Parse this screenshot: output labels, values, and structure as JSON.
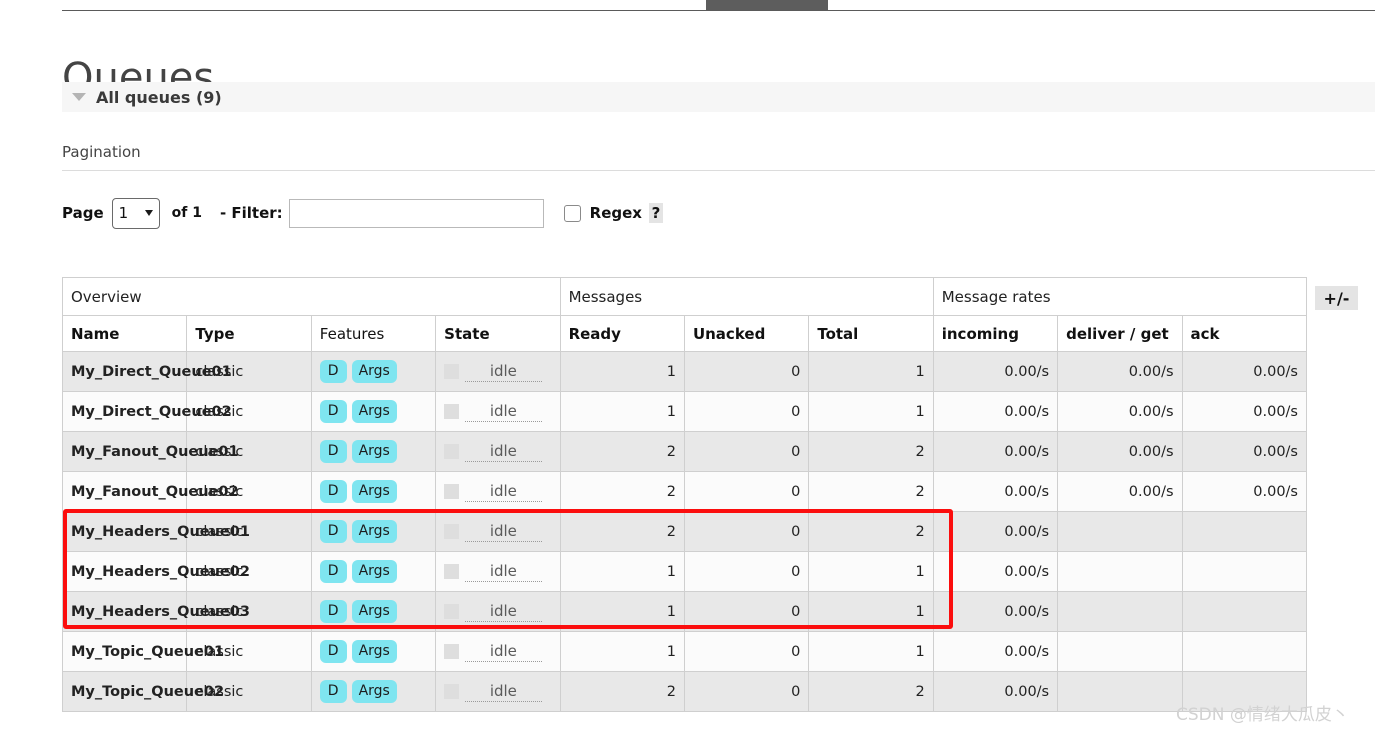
{
  "page": {
    "title": "Queues",
    "section_label": "All queues (9)",
    "watermark": "CSDN @情绪大瓜皮丶"
  },
  "pagination": {
    "heading": "Pagination",
    "page_label": "Page",
    "page_value": "1",
    "of_label": "of 1",
    "filter_label": "- Filter:",
    "filter_value": "",
    "filter_placeholder": "",
    "regex_label": "Regex",
    "help_label": "?",
    "page_options": [
      "1"
    ]
  },
  "table": {
    "toggle_columns_label": "+/-",
    "group_headers": [
      {
        "label": "Overview",
        "span": 4
      },
      {
        "label": "Messages",
        "span": 3
      },
      {
        "label": "Message rates",
        "span": 3
      }
    ],
    "columns": [
      {
        "label": "Name",
        "align": "left",
        "bold": true
      },
      {
        "label": "Type",
        "align": "left",
        "bold": true
      },
      {
        "label": "Features",
        "align": "left",
        "bold": false
      },
      {
        "label": "State",
        "align": "left",
        "bold": true
      },
      {
        "label": "Ready",
        "align": "left",
        "bold": true
      },
      {
        "label": "Unacked",
        "align": "left",
        "bold": true
      },
      {
        "label": "Total",
        "align": "left",
        "bold": true
      },
      {
        "label": "incoming",
        "align": "left",
        "bold": true
      },
      {
        "label": "deliver / get",
        "align": "left",
        "bold": true
      },
      {
        "label": "ack",
        "align": "left",
        "bold": true
      }
    ],
    "feature_badges": [
      "D",
      "Args"
    ],
    "rows": [
      {
        "name": "My_Direct_Queue01",
        "type": "classic",
        "features": [
          "D",
          "Args"
        ],
        "state": "idle",
        "ready": "1",
        "unacked": "0",
        "total": "1",
        "incoming": "0.00/s",
        "deliver_get": "0.00/s",
        "ack": "0.00/s",
        "highlighted": false
      },
      {
        "name": "My_Direct_Queue02",
        "type": "classic",
        "features": [
          "D",
          "Args"
        ],
        "state": "idle",
        "ready": "1",
        "unacked": "0",
        "total": "1",
        "incoming": "0.00/s",
        "deliver_get": "0.00/s",
        "ack": "0.00/s",
        "highlighted": false
      },
      {
        "name": "My_Fanout_Queue01",
        "type": "classic",
        "features": [
          "D",
          "Args"
        ],
        "state": "idle",
        "ready": "2",
        "unacked": "0",
        "total": "2",
        "incoming": "0.00/s",
        "deliver_get": "0.00/s",
        "ack": "0.00/s",
        "highlighted": false
      },
      {
        "name": "My_Fanout_Queue02",
        "type": "classic",
        "features": [
          "D",
          "Args"
        ],
        "state": "idle",
        "ready": "2",
        "unacked": "0",
        "total": "2",
        "incoming": "0.00/s",
        "deliver_get": "0.00/s",
        "ack": "0.00/s",
        "highlighted": false
      },
      {
        "name": "My_Headers_Queue01",
        "type": "classic",
        "features": [
          "D",
          "Args"
        ],
        "state": "idle",
        "ready": "2",
        "unacked": "0",
        "total": "2",
        "incoming": "0.00/s",
        "deliver_get": "",
        "ack": "",
        "highlighted": true
      },
      {
        "name": "My_Headers_Queue02",
        "type": "classic",
        "features": [
          "D",
          "Args"
        ],
        "state": "idle",
        "ready": "1",
        "unacked": "0",
        "total": "1",
        "incoming": "0.00/s",
        "deliver_get": "",
        "ack": "",
        "highlighted": true
      },
      {
        "name": "My_Headers_Queue03",
        "type": "classic",
        "features": [
          "D",
          "Args"
        ],
        "state": "idle",
        "ready": "1",
        "unacked": "0",
        "total": "1",
        "incoming": "0.00/s",
        "deliver_get": "",
        "ack": "",
        "highlighted": true
      },
      {
        "name": "My_Topic_Queue01",
        "type": "classic",
        "features": [
          "D",
          "Args"
        ],
        "state": "idle",
        "ready": "1",
        "unacked": "0",
        "total": "1",
        "incoming": "0.00/s",
        "deliver_get": "",
        "ack": "",
        "highlighted": false
      },
      {
        "name": "My_Topic_Queue02",
        "type": "classic",
        "features": [
          "D",
          "Args"
        ],
        "state": "idle",
        "ready": "2",
        "unacked": "0",
        "total": "2",
        "incoming": "0.00/s",
        "deliver_get": "",
        "ack": "",
        "highlighted": false
      }
    ]
  },
  "colors": {
    "badge_bg": "#7fe5f0",
    "annotation": "#fb0d0d",
    "row_odd": "#e8e8e8",
    "row_even": "#fbfbfb",
    "section_bar": "#f6f6f6"
  }
}
